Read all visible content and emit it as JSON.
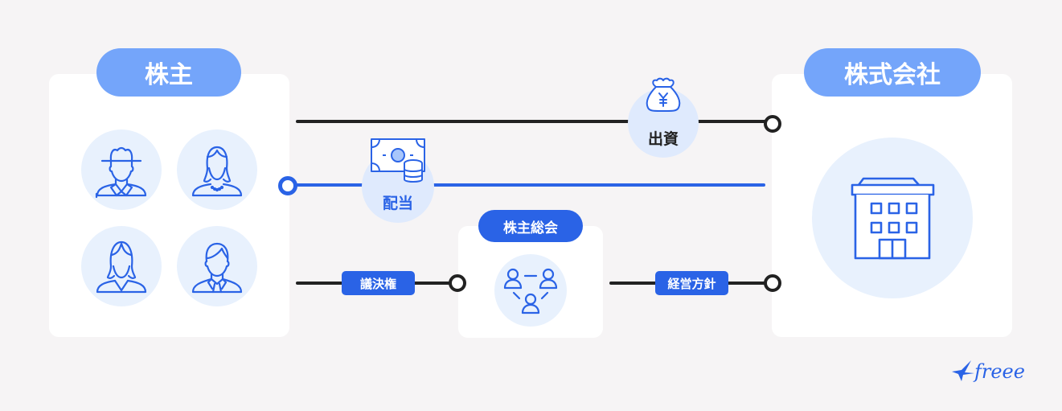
{
  "shareholders": {
    "label": "株主",
    "avatars": [
      "man-hat-avatar",
      "woman-necklace-avatar",
      "woman-long-hair-avatar",
      "man-tie-avatar"
    ]
  },
  "company": {
    "label": "株式会社",
    "icon": "building-icon"
  },
  "meeting": {
    "label": "株主総会",
    "icon": "people-meeting-icon"
  },
  "flows": {
    "investment": {
      "label": "出資",
      "icon": "money-bag-yen-icon",
      "color": "#222222"
    },
    "dividend": {
      "label": "配当",
      "icon": "cash-coins-icon",
      "color": "#2a63e6"
    },
    "voting_rights": {
      "label": "議決権",
      "color": "#222222"
    },
    "management_policy": {
      "label": "経営方針",
      "color": "#222222"
    }
  },
  "brand": {
    "logo": "freee"
  },
  "colors": {
    "accent": "#2a63e6",
    "pill_light": "#74a5fa",
    "circle_bg": "#e8f1fd",
    "line_dark": "#222222",
    "background": "#f6f4f5"
  }
}
